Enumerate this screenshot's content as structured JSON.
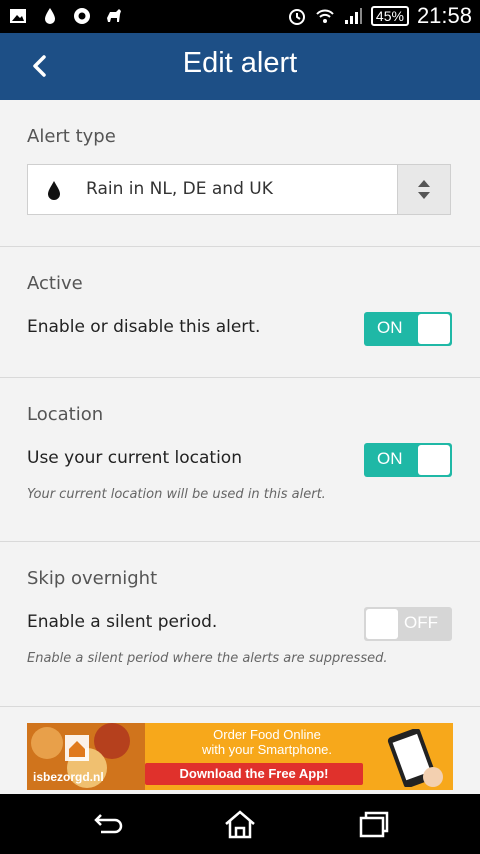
{
  "status_bar": {
    "battery": "45%",
    "time": "21:58",
    "icons": [
      "gallery-icon",
      "drop-icon",
      "circle-app-icon",
      "animal-icon",
      "alarm-icon",
      "wifi-icon",
      "signal-icon"
    ]
  },
  "app_bar": {
    "title": "Edit alert",
    "back_icon": "chevron-left-icon"
  },
  "alert_type": {
    "heading": "Alert type",
    "selected": "Rain in NL, DE and UK",
    "option_icon": "drop-icon"
  },
  "active": {
    "heading": "Active",
    "label": "Enable or disable this alert.",
    "toggle": "ON"
  },
  "location": {
    "heading": "Location",
    "label": "Use your current location",
    "hint": "Your current location will be used in this alert.",
    "toggle": "ON"
  },
  "skip_overnight": {
    "heading": "Skip overnight",
    "label": "Enable a silent period.",
    "hint": "Enable a silent period where the alerts are suppressed.",
    "toggle": "OFF"
  },
  "ad": {
    "line1": "Order Food Online",
    "line2": "with your Smartphone.",
    "cta": "Download the Free App!",
    "brand": "isbezorgd.nl"
  },
  "colors": {
    "app_bar": "#1d4f86",
    "toggle_on": "#1fb8a6",
    "toggle_off": "#d6d6d6",
    "ad_bg": "#f7a81b",
    "ad_cta": "#e0312c"
  }
}
